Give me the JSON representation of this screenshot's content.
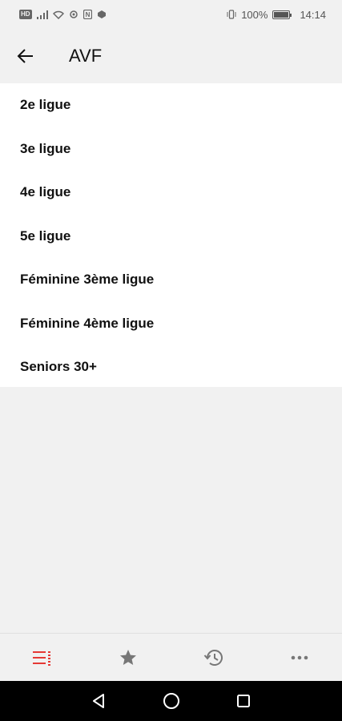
{
  "status_bar": {
    "left_icons": [
      "sim-icon",
      "signal-icon",
      "wifi-icon",
      "eye-comfort-icon",
      "nfc-icon",
      "data-saver-icon"
    ],
    "vibrate_icon": "vibrate-icon",
    "battery_text": "100%",
    "battery_level": 1.0,
    "time": "14:14"
  },
  "app_bar": {
    "back_icon": "arrow-left-icon",
    "title": "AVF"
  },
  "list": {
    "items": [
      {
        "label": "2e ligue"
      },
      {
        "label": "3e ligue"
      },
      {
        "label": "4e ligue"
      },
      {
        "label": "5e ligue"
      },
      {
        "label": "Féminine 3ème ligue"
      },
      {
        "label": "Féminine 4ème ligue"
      },
      {
        "label": "Seniors 30+"
      }
    ]
  },
  "bottom_nav": {
    "items": [
      {
        "icon": "list-icon",
        "active": true
      },
      {
        "icon": "star-icon",
        "active": false
      },
      {
        "icon": "history-icon",
        "active": false
      },
      {
        "icon": "more-icon",
        "active": false
      }
    ],
    "active_color": "#e53935",
    "inactive_color": "#777777"
  },
  "system_nav": {
    "items": [
      "back-triangle-icon",
      "home-circle-icon",
      "recents-square-icon"
    ]
  }
}
